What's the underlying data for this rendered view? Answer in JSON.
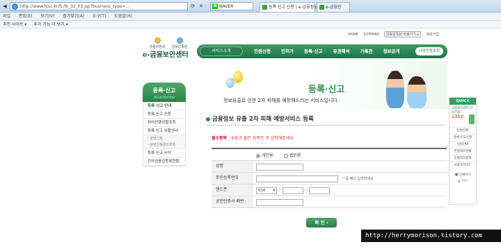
{
  "browser": {
    "address": "http://www.fcsc.kr/fc/lb_02_03.jsp?business_type=...",
    "search_engine": "NAVER",
    "tabs": [
      {
        "label": "등록·신고 신청 | e-금융정보"
      },
      {
        "label": "e-금융민"
      }
    ],
    "menu": [
      "파일",
      "편집(E)",
      "보기(V)",
      "즐겨찾기(A)",
      "도구(T)",
      "도움말(H)"
    ],
    "favorites": [
      "추천 사이트 ▾",
      "추가 기능 더 보기 ▾"
    ]
  },
  "site": {
    "top_links": [
      "HOME",
      "SITEMAP",
      "금융감독원 바로가기 ▸",
      "회원가입"
    ],
    "org1": "금융위원회",
    "org2": "금융감독원",
    "title": "e-금융보안센터",
    "gnb": {
      "service_intro": "서비스소개",
      "menu": [
        "민원신청",
        "인허가",
        "등록·신고",
        "유권해석",
        "기록관",
        "정보공개"
      ],
      "last": "나의민원조회"
    },
    "banner": {
      "title": "등록·신고",
      "subtitle": "정보유출로 인한 2차 피해를 예방해드리는 서비스입니다."
    }
  },
  "sidebar": {
    "title": "등록·신고",
    "subtitle": "REGISTRATION",
    "items": [
      {
        "label": "등록·신고 안내",
        "active": true
      },
      {
        "label": "등록·신고 신청",
        "active": false
      },
      {
        "label": "처리진행상황조회",
        "active": false
      },
      {
        "label": "등록·신고 상황안내",
        "active": false
      }
    ],
    "sub_items": [
      "- 상담신청",
      "- 상담신청결과조회"
    ],
    "items2": [
      {
        "label": "등록·신고 서식"
      },
      {
        "label": "전자금융업등록현황"
      }
    ]
  },
  "form": {
    "title": "금융정보 유출 2차 피해 예방서비스 등록",
    "required_label": "필수항목",
    "required_text": "※표가 붙은 항목은 꼭 입력해주세요",
    "type_options": {
      "individual": "개인용",
      "corporate": "법인용"
    },
    "fields": {
      "name": "성명",
      "rrn": "주민등록번호",
      "rrn_hint": "'-'를 빼고 입력하세요",
      "phone": "핸드폰",
      "phone_prefix": "010",
      "cert": "공인인증서 배번"
    },
    "submit": "확 인 ›"
  },
  "quick": {
    "title": "QUICK",
    "call_text": "금융보안센터 상담전화",
    "call_number": "1332",
    "items": [
      "민원신청",
      "등록·신고신청",
      "민원안내",
      "민원처리현황",
      "민원처리결과",
      "사용자가이드"
    ],
    "print": "인쇄하기",
    "top": "▲ TOP"
  },
  "watermark": "http://herrymorison.tistory.com"
}
